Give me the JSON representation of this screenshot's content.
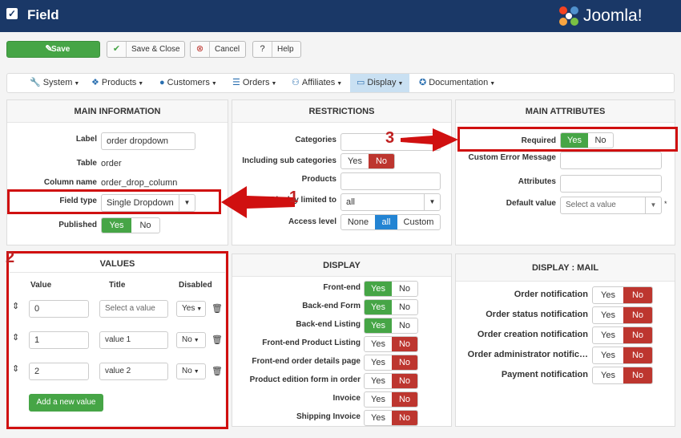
{
  "header": {
    "title": "Field",
    "logo_text": "Joomla!"
  },
  "toolbar": {
    "save": "Save",
    "save_close": "Save & Close",
    "cancel": "Cancel",
    "help": "Help"
  },
  "menu": [
    "System",
    "Products",
    "Customers",
    "Orders",
    "Affiliates",
    "Display",
    "Documentation"
  ],
  "main_info": {
    "title": "MAIN INFORMATION",
    "label_label": "Label",
    "label_value": "order dropdown",
    "table_label": "Table",
    "table_value": "order",
    "column_label": "Column name",
    "column_value": "order_drop_column",
    "fieldtype_label": "Field type",
    "fieldtype_value": "Single Dropdown",
    "published_label": "Published",
    "yes": "Yes",
    "no": "No"
  },
  "restrictions": {
    "title": "RESTRICTIONS",
    "categories": "Categories",
    "sub_categories": "Including sub categories",
    "products": "Products",
    "display_limited": "Display limited to",
    "display_limited_value": "all",
    "access": "Access level",
    "access_none": "None",
    "access_all": "all",
    "access_custom": "Custom",
    "yes": "Yes",
    "no": "No"
  },
  "attributes": {
    "title": "MAIN ATTRIBUTES",
    "required": "Required",
    "custom_error": "Custom Error Message",
    "attributes": "Attributes",
    "default": "Default value",
    "default_placeholder": "Select a value",
    "asterisk": "*",
    "yes": "Yes",
    "no": "No"
  },
  "values": {
    "title": "VALUES",
    "col_value": "Value",
    "col_title": "Title",
    "col_disabled": "Disabled",
    "rows": [
      {
        "value": "0",
        "title": "Select a value",
        "disabled": "Yes"
      },
      {
        "value": "1",
        "title": "value 1",
        "disabled": "No"
      },
      {
        "value": "2",
        "title": "value 2",
        "disabled": "No"
      }
    ],
    "add_button": "Add a new value"
  },
  "display": {
    "title": "DISPLAY",
    "rows": [
      {
        "label": "Front-end",
        "state": "yes"
      },
      {
        "label": "Back-end Form",
        "state": "yes"
      },
      {
        "label": "Back-end Listing",
        "state": "yes"
      },
      {
        "label": "Front-end Product Listing",
        "state": "no"
      },
      {
        "label": "Front-end order details page",
        "state": "no"
      },
      {
        "label": "Product edition form in order",
        "state": "no"
      },
      {
        "label": "Invoice",
        "state": "no"
      },
      {
        "label": "Shipping Invoice",
        "state": "no"
      }
    ],
    "yes": "Yes",
    "no": "No"
  },
  "display_mail": {
    "title": "DISPLAY : MAIL",
    "rows": [
      {
        "label": "Order notification",
        "state": "no"
      },
      {
        "label": "Order status notification",
        "state": "no"
      },
      {
        "label": "Order creation notification",
        "state": "no"
      },
      {
        "label": "Order administrator notific…",
        "state": "no"
      },
      {
        "label": "Payment notification",
        "state": "no"
      }
    ],
    "yes": "Yes",
    "no": "No"
  },
  "callouts": {
    "one": "1",
    "two": "2",
    "three": "3"
  },
  "colors": {
    "header": "#1a3867",
    "green": "#46a546",
    "red": "#bd362f",
    "blue": "#2384d3",
    "callout": "#d01010"
  }
}
